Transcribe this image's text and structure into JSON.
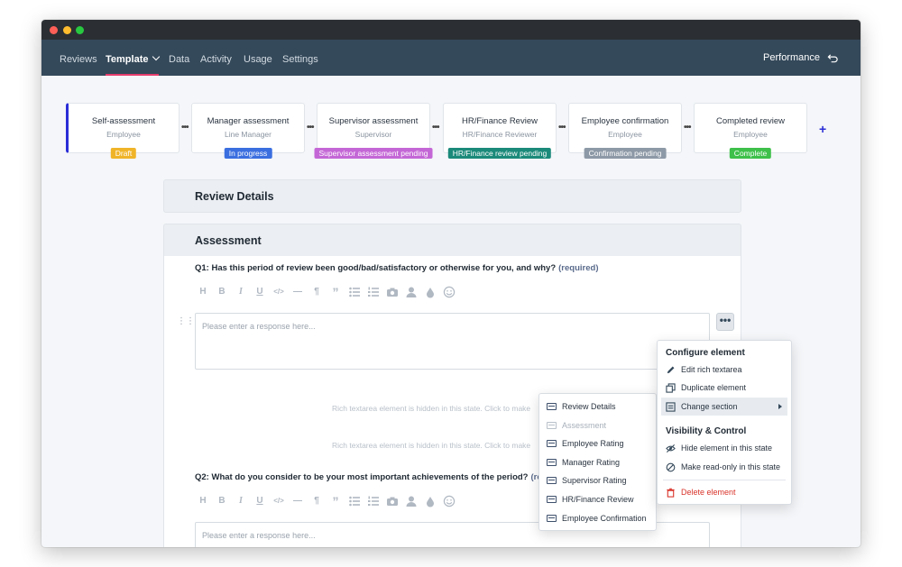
{
  "nav": {
    "items": [
      "Reviews",
      "Template",
      "Data",
      "Activity",
      "Usage",
      "Settings"
    ],
    "active": "Template",
    "right_label": "Performance"
  },
  "workflow": {
    "stages": [
      {
        "title": "Self-assessment",
        "role": "Employee",
        "badge": "Draft",
        "badge_color": "#f0b429"
      },
      {
        "title": "Manager assessment",
        "role": "Line Manager",
        "badge": "In progress",
        "badge_color": "#3b6fe0"
      },
      {
        "title": "Supervisor assessment",
        "role": "Supervisor",
        "badge": "Supervisor assessment pending",
        "badge_color": "#c467d6"
      },
      {
        "title": "HR/Finance Review",
        "role": "HR/Finance Reviewer",
        "badge": "HR/Finance review pending",
        "badge_color": "#1b8a7a"
      },
      {
        "title": "Employee confirmation",
        "role": "Employee",
        "badge": "Confirmation pending",
        "badge_color": "#8d99a6"
      },
      {
        "title": "Completed review",
        "role": "Employee",
        "badge": "Complete",
        "badge_color": "#3ec04a"
      }
    ],
    "connector": "•••",
    "add": "+"
  },
  "sections": {
    "review_details": "Review Details",
    "assessment": "Assessment"
  },
  "questions": {
    "q1": "Q1: Has this period of review been good/bad/satisfactory or otherwise for you, and why?",
    "q1_required": "(required)",
    "q2": "Q2: What do you consider to be your most important achievements of the period?",
    "q2_required": "(requi",
    "placeholder": "Please enter a response here..."
  },
  "toolbar": {
    "heading": "H",
    "bold": "B",
    "italic": "I",
    "underline": "U",
    "code": "</>",
    "hr": "—",
    "para": "¶",
    "quote": "”",
    "bullets": "bulleted-list-icon",
    "numbered": "numbered-list-icon",
    "camera": "camera-icon",
    "person": "person-icon",
    "drop": "drop-icon",
    "smile": "smiley-icon"
  },
  "hidden_notes": [
    "Rich textarea element is hidden in this state. Click to make",
    "Rich textarea element is hidden in this state. Click to make"
  ],
  "more_button": "•••",
  "config_menu": {
    "heading": "Configure element",
    "items": [
      "Edit rich textarea",
      "Duplicate element",
      "Change section"
    ],
    "heading2": "Visibility & Control",
    "items2": [
      "Hide element in this state",
      "Make read-only in this state"
    ],
    "delete": "Delete element"
  },
  "section_submenu": {
    "items": [
      "Review Details",
      "Assessment",
      "Employee Rating",
      "Manager Rating",
      "Supervisor Rating",
      "HR/Finance Review",
      "Employee Confirmation"
    ],
    "disabled": "Assessment"
  }
}
